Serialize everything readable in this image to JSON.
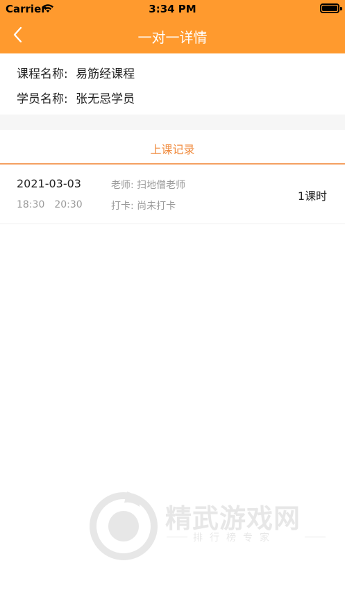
{
  "status_bar": {
    "carrier": "Carrier",
    "time": "3:34 PM"
  },
  "nav": {
    "title": "一对一详情",
    "back_icon": "chevron-left-icon"
  },
  "info": {
    "course_label": "课程名称:",
    "course_value": "易筋经课程",
    "student_label": "学员名称:",
    "student_value": "张无忌学员"
  },
  "tab": {
    "label": "上课记录"
  },
  "records": [
    {
      "date": "2021-03-03",
      "start": "18:30",
      "end": "20:30",
      "teacher": "老师: 扫地僧老师",
      "punch": "打卡: 尚未打卡",
      "hours": "1课时"
    }
  ],
  "watermark": {
    "title": "精武游戏网",
    "subtitle": "排行榜专家"
  },
  "colors": {
    "accent": "#FF9A2E",
    "tab_text": "#F08A3C",
    "muted": "#9A9A9A"
  }
}
